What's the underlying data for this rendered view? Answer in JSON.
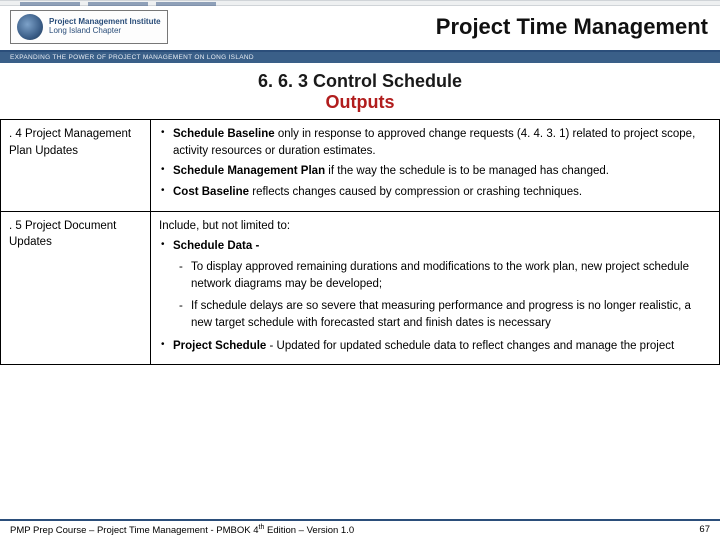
{
  "header": {
    "logo_line1": "Project Management Institute",
    "logo_line2": "Long Island Chapter",
    "page_title": "Project Time Management",
    "tagline": "EXPANDING THE POWER OF PROJECT MANAGEMENT ON LONG ISLAND"
  },
  "section": {
    "title": "6. 6. 3 Control Schedule",
    "subtitle": "Outputs"
  },
  "rows": [
    {
      "label": ". 4 Project Management Plan Updates",
      "lead": "",
      "bullets": [
        {
          "bold": "Schedule Baseline",
          "rest": " only in response to approved change requests (4. 4. 3. 1) related to project scope, activity resources or duration estimates."
        },
        {
          "bold": "Schedule Management Plan",
          "rest": " if the way the schedule is to be managed has changed."
        },
        {
          "bold": "Cost Baseline ",
          "rest": " reflects changes caused by compression or crashing techniques."
        }
      ],
      "sub": []
    },
    {
      "label": ". 5 Project Document Updates",
      "lead": "Include, but not limited to:",
      "bullets": [
        {
          "bold": "Schedule Data -",
          "rest": ""
        }
      ],
      "sub": [
        "To display approved remaining durations and modifications to the work plan, new project schedule network diagrams may be developed;",
        "If schedule delays are so severe that measuring performance and progress is no longer realistic, a new target schedule with forecasted start and finish dates is necessary"
      ],
      "bullets2": [
        {
          "bold": "Project Schedule",
          "rest": " - Updated for updated schedule data to reflect changes and manage the project"
        }
      ]
    }
  ],
  "footer": {
    "left_a": "PMP Prep Course – Project Time Management - PMBOK 4",
    "left_sup": "th",
    "left_b": " Edition – Version 1.0",
    "page": "67"
  }
}
